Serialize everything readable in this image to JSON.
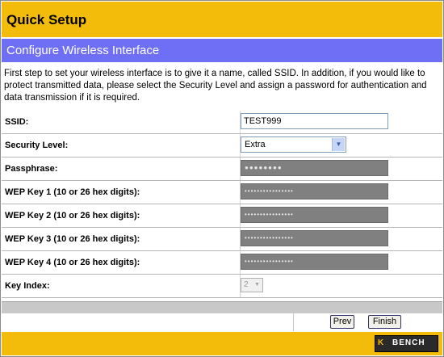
{
  "header": {
    "title": "Quick Setup"
  },
  "section": {
    "title": "Configure Wireless Interface"
  },
  "intro": "First step to set your wireless interface is to give it a name, called SSID. In addition, if you would like to protect transmitted data, please select the Security Level and assign a password for authentication and data transmission if it is required.",
  "form": {
    "ssid": {
      "label": "SSID:",
      "value": "TEST999"
    },
    "security": {
      "label": "Security Level:",
      "value": "Extra"
    },
    "passphrase": {
      "label": "Passphrase:",
      "mask": "●●●●●●●●"
    },
    "wep1": {
      "label": "WEP Key 1 (10 or 26 hex digits):",
      "mask": "••••••••••••••••"
    },
    "wep2": {
      "label": "WEP Key 2 (10 or 26 hex digits):",
      "mask": "••••••••••••••••"
    },
    "wep3": {
      "label": "WEP Key 3 (10 or 26 hex digits):",
      "mask": "••••••••••••••••"
    },
    "wep4": {
      "label": "WEP Key 4 (10 or 26 hex digits):",
      "mask": "••••••••••••••••"
    },
    "key_index": {
      "label": "Key Index:",
      "value": "2"
    }
  },
  "buttons": {
    "prev": "Prev",
    "finish": "Finish"
  },
  "brand": {
    "mark": "K",
    "name": "BENCH"
  },
  "colors": {
    "header_bg": "#f4bc0a",
    "section_bg": "#6f6ff6",
    "disabled_field": "#808080"
  }
}
